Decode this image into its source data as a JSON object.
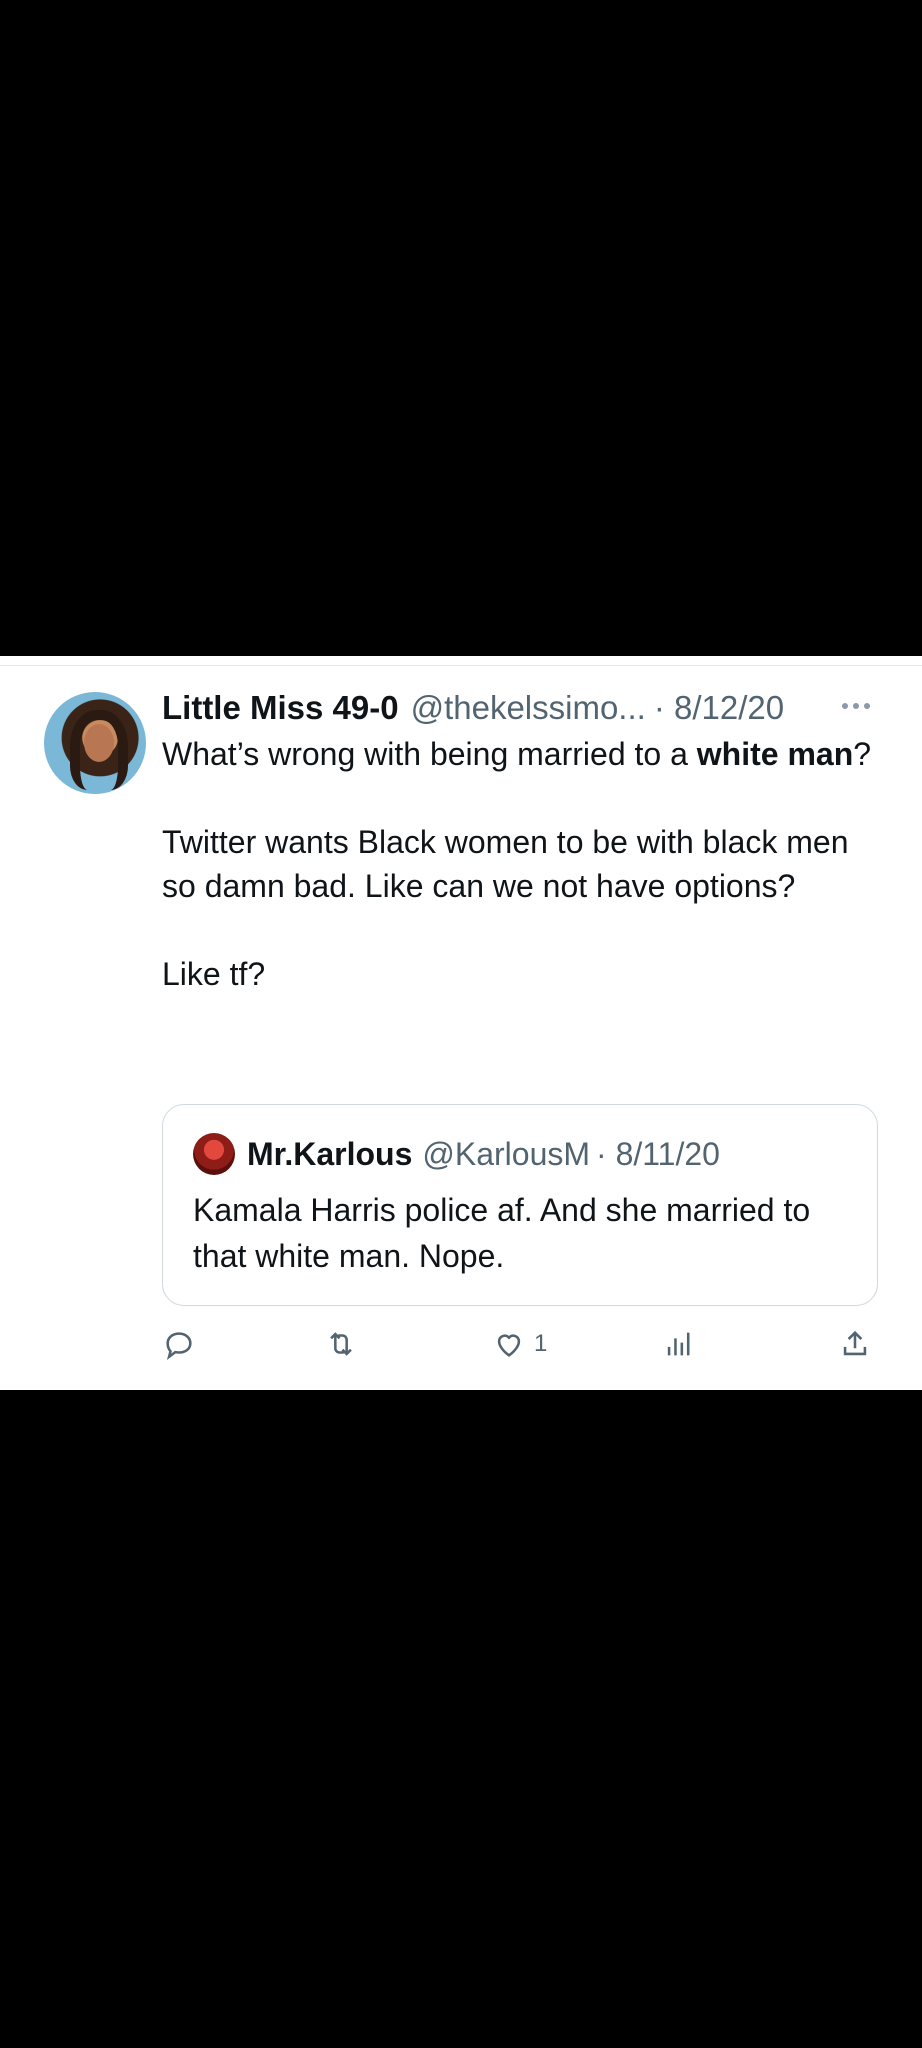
{
  "tweet": {
    "name": "Little Miss 49-0",
    "handle": "@thekelssimo...",
    "date": "· 8/12/20",
    "line1_pre": "What’s wrong with being married to a ",
    "line1_bold": "white man",
    "line1_post": "?",
    "para2": "Twitter wants Black women to be with black men so damn bad. Like can we not have options?",
    "para3": "Like tf?"
  },
  "quoted": {
    "name": "Mr.Karlous",
    "handle": "@KarlousM",
    "date": "· 8/11/20",
    "text": "Kamala Harris police af. And she married to that white man. Nope."
  },
  "actions": {
    "like_count": "1"
  },
  "icons": [
    "reply-icon",
    "retweet-icon",
    "like-icon",
    "views-icon",
    "share-icon",
    "more-icon"
  ],
  "colors": {
    "text": "#0f1419",
    "muted": "#536471",
    "border": "#cfd9de"
  }
}
